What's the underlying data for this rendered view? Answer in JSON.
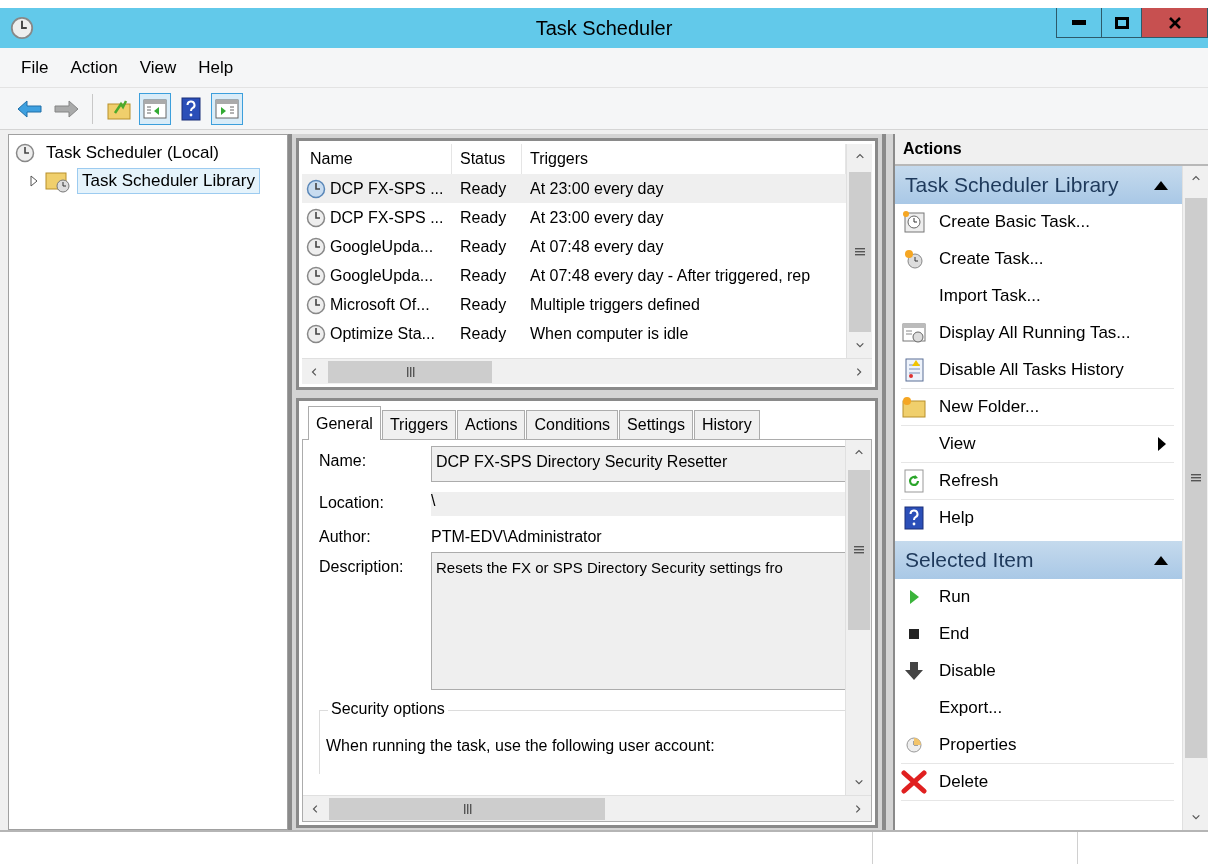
{
  "window": {
    "title": "Task Scheduler"
  },
  "menu": [
    "File",
    "Action",
    "View",
    "Help"
  ],
  "toolbar": [
    {
      "kind": "back",
      "disabled": false,
      "pressed": false
    },
    {
      "kind": "forward",
      "disabled": true,
      "pressed": false
    },
    {
      "kind": "up-folder",
      "disabled": false,
      "pressed": false
    },
    {
      "kind": "console-tree",
      "disabled": false,
      "pressed": true
    },
    {
      "kind": "help",
      "disabled": false,
      "pressed": false
    },
    {
      "kind": "action-pane",
      "disabled": false,
      "pressed": true
    }
  ],
  "tree": [
    {
      "label": "Task Scheduler (Local)",
      "selected": false,
      "expanded": true,
      "children": [
        {
          "label": "Task Scheduler Library",
          "selected": true,
          "expanded": false
        }
      ]
    }
  ],
  "task_list": {
    "columns": [
      "Name",
      "Status",
      "Triggers"
    ],
    "rows": [
      {
        "name": "DCP FX-SPS ...",
        "status": "Ready",
        "triggers": "At 23:00 every day",
        "selected": true
      },
      {
        "name": "DCP FX-SPS ...",
        "status": "Ready",
        "triggers": "At 23:00 every day",
        "selected": false
      },
      {
        "name": "GoogleUpda...",
        "status": "Ready",
        "triggers": "At 07:48 every day",
        "selected": false
      },
      {
        "name": "GoogleUpda...",
        "status": "Ready",
        "triggers": "At 07:48 every day - After triggered, rep",
        "selected": false
      },
      {
        "name": "Microsoft Of...",
        "status": "Ready",
        "triggers": "Multiple triggers defined",
        "selected": false
      },
      {
        "name": "Optimize Sta...",
        "status": "Ready",
        "triggers": "When computer is idle",
        "selected": false
      }
    ]
  },
  "detail": {
    "tabs": [
      {
        "label": "General",
        "selected": true
      },
      {
        "label": "Triggers",
        "selected": false
      },
      {
        "label": "Actions",
        "selected": false
      },
      {
        "label": "Conditions",
        "selected": false
      },
      {
        "label": "Settings",
        "selected": false
      },
      {
        "label": "History",
        "selected": false
      }
    ],
    "fields": [
      {
        "kind": "input",
        "label": "Name:",
        "value": "DCP FX-SPS Directory Security Resetter"
      },
      {
        "kind": "shaded",
        "label": "Location:",
        "value": "\\"
      },
      {
        "kind": "plain",
        "label": "Author:",
        "value": "PTM-EDV\\Administrator"
      },
      {
        "kind": "area",
        "label": "Description:",
        "value": "Resets the FX or SPS Directory Security settings fro"
      }
    ],
    "security_options": {
      "title": "Security options",
      "text": "When running the task, use the following user account:"
    }
  },
  "actions": {
    "title": "Actions",
    "sections": [
      {
        "title": "Task Scheduler Library",
        "expanded": true,
        "items": [
          {
            "label": "Create Basic Task...",
            "kind": "basic-task",
            "submenu": false,
            "separator": false
          },
          {
            "label": "Create Task...",
            "kind": "task",
            "submenu": false,
            "separator": false
          },
          {
            "label": "Import Task...",
            "kind": "plain",
            "submenu": false,
            "separator": false
          },
          {
            "label": "Display All Running Tas...",
            "kind": "running",
            "submenu": false,
            "separator": false
          },
          {
            "label": "Disable All Tasks History",
            "kind": "history",
            "submenu": false,
            "separator": true
          },
          {
            "label": "New Folder...",
            "kind": "folder",
            "submenu": false,
            "separator": true
          },
          {
            "label": "View",
            "kind": "plain",
            "submenu": true,
            "separator": true
          },
          {
            "label": "Refresh",
            "kind": "refresh",
            "submenu": false,
            "separator": true
          },
          {
            "label": "Help",
            "kind": "help",
            "submenu": false,
            "separator": false
          }
        ]
      },
      {
        "title": "Selected Item",
        "expanded": true,
        "items": [
          {
            "label": "Run",
            "kind": "run",
            "submenu": false,
            "separator": false
          },
          {
            "label": "End",
            "kind": "end",
            "submenu": false,
            "separator": false
          },
          {
            "label": "Disable",
            "kind": "disable",
            "submenu": false,
            "separator": false
          },
          {
            "label": "Export...",
            "kind": "plain",
            "submenu": false,
            "separator": false
          },
          {
            "label": "Properties",
            "kind": "properties",
            "submenu": false,
            "separator": true
          },
          {
            "label": "Delete",
            "kind": "delete",
            "submenu": false,
            "separator": true
          }
        ]
      }
    ]
  }
}
